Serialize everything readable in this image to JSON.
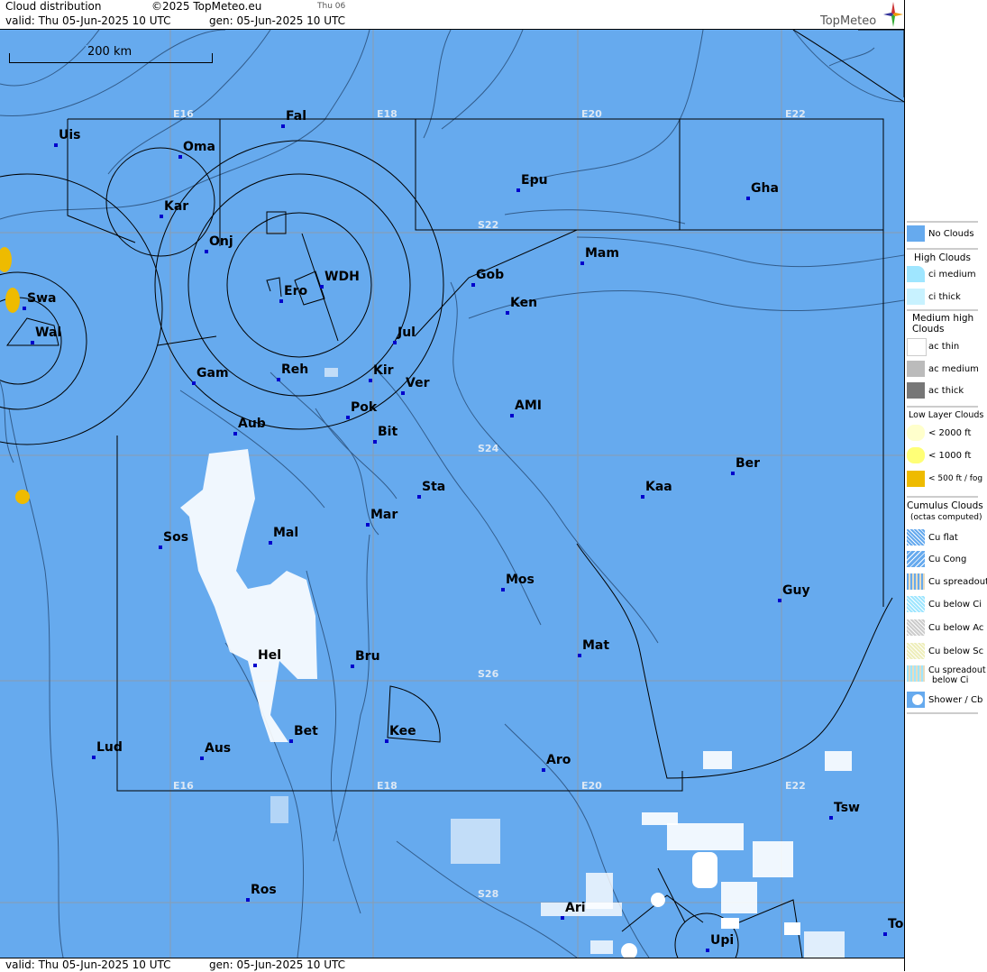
{
  "header": {
    "product": "Cloud distribution",
    "copyright": "©2025 TopMeteo.eu",
    "day": "Thu 06",
    "valid": "valid:  Thu  05-Jun-2025  10 UTC",
    "generated": "gen: 05-Jun-2025 10 UTC",
    "logo_text": "TopMeteo"
  },
  "footer": {
    "valid": "valid:  Thu  05-Jun-2025  10 UTC",
    "generated": "gen: 05-Jun-2025 10 UTC"
  },
  "map": {
    "scale_label": "200 km",
    "grid_labels": [
      "E16",
      "E18",
      "E20",
      "E22",
      "S22",
      "S24",
      "S26",
      "S28",
      "E16",
      "E18",
      "E20",
      "E22"
    ],
    "cities": [
      "Uis",
      "Fal",
      "Oma",
      "Kar",
      "Onj",
      "Swa",
      "Wal",
      "Ero",
      "WDH",
      "Epu",
      "Gha",
      "Mam",
      "Gob",
      "Ken",
      "Jul",
      "Gam",
      "Reh",
      "Kir",
      "Ver",
      "AMI",
      "Pok",
      "Bit",
      "Aub",
      "Ber",
      "Sta",
      "Kaa",
      "Mar",
      "Sos",
      "Mal",
      "Mos",
      "Guy",
      "Mat",
      "Hel",
      "Bru",
      "Bet",
      "Kee",
      "Lud",
      "Aus",
      "Aro",
      "Tsw",
      "Ros",
      "Ari",
      "Upi",
      "To"
    ],
    "colors": {
      "no_clouds": "#66aaee",
      "fog": "#eebb00",
      "cumulus": "#ffffff",
      "grid": "#999999",
      "border": "#000000"
    }
  },
  "legend": {
    "no_clouds": "No Clouds",
    "high_title": "High Clouds",
    "ci_medium": "ci medium",
    "ci_thick": "ci thick",
    "medium_title": "Medium high Clouds",
    "ac_thin": "ac thin",
    "ac_medium": "ac medium",
    "ac_thick": "ac thick",
    "low_title": "Low Layer Clouds",
    "low_2000": "< 2000 ft",
    "low_1000": "< 1000 ft",
    "low_500": "< 500 ft / fog",
    "cumulus_title": "Cumulus Clouds",
    "cumulus_sub": "(octas computed)",
    "cu_flat": "Cu flat",
    "cu_cong": "Cu Cong",
    "cu_spreadout": "Cu spreadout",
    "cu_below_ci": "Cu below Ci",
    "cu_below_ac": "Cu below Ac",
    "cu_below_sc": "Cu below Sc",
    "cu_spread_ci_1": "Cu spreadout",
    "cu_spread_ci_2": "below Ci",
    "shower": "Shower / Cb"
  }
}
